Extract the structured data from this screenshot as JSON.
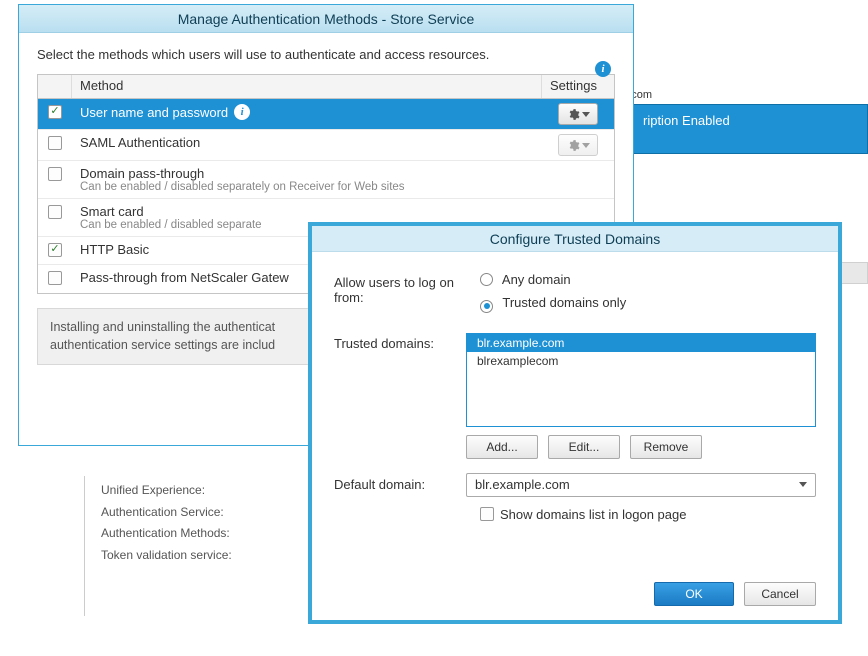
{
  "bg": {
    "breadcrumb": "blr.example.com",
    "panel_label": "ription Enabled",
    "info_lines": [
      "Unified Experience:",
      "Authentication Service:",
      "Authentication Methods:",
      "",
      "Token validation service:"
    ]
  },
  "dlg1": {
    "title": "Manage Authentication Methods - Store Service",
    "prompt": "Select the methods which users will use to authenticate and access resources.",
    "col_method": "Method",
    "col_settings": "Settings",
    "rows": [
      {
        "label": "User name and password",
        "checked": true,
        "selected": true,
        "gear": true,
        "info": true
      },
      {
        "label": "SAML Authentication",
        "checked": false,
        "selected": false,
        "gear": true,
        "gear_disabled": true
      },
      {
        "label": "Domain pass-through",
        "checked": false,
        "selected": false,
        "sub": "Can be enabled / disabled separately on Receiver for Web sites"
      },
      {
        "label": "Smart card",
        "checked": false,
        "selected": false,
        "sub": "Can be enabled / disabled separate"
      },
      {
        "label": "HTTP Basic",
        "checked": true,
        "selected": false
      },
      {
        "label": "Pass-through from NetScaler Gatew",
        "checked": false,
        "selected": false
      }
    ],
    "info_msg": "Installing and uninstalling the authenticat\nauthentication service settings are includ"
  },
  "dlg2": {
    "title": "Configure Trusted Domains",
    "allow_label": "Allow users to log on from:",
    "opt_any": "Any domain",
    "opt_trusted": "Trusted domains only",
    "selected_option": "trusted",
    "trusted_label": "Trusted domains:",
    "domains": [
      {
        "name": "blr.example.com",
        "selected": true
      },
      {
        "name": "blrexamplecom",
        "selected": false
      }
    ],
    "btn_add": "Add...",
    "btn_edit": "Edit...",
    "btn_remove": "Remove",
    "default_label": "Default domain:",
    "default_value": "blr.example.com",
    "show_list": "Show domains list in logon page",
    "show_list_checked": false,
    "ok": "OK",
    "cancel": "Cancel"
  }
}
